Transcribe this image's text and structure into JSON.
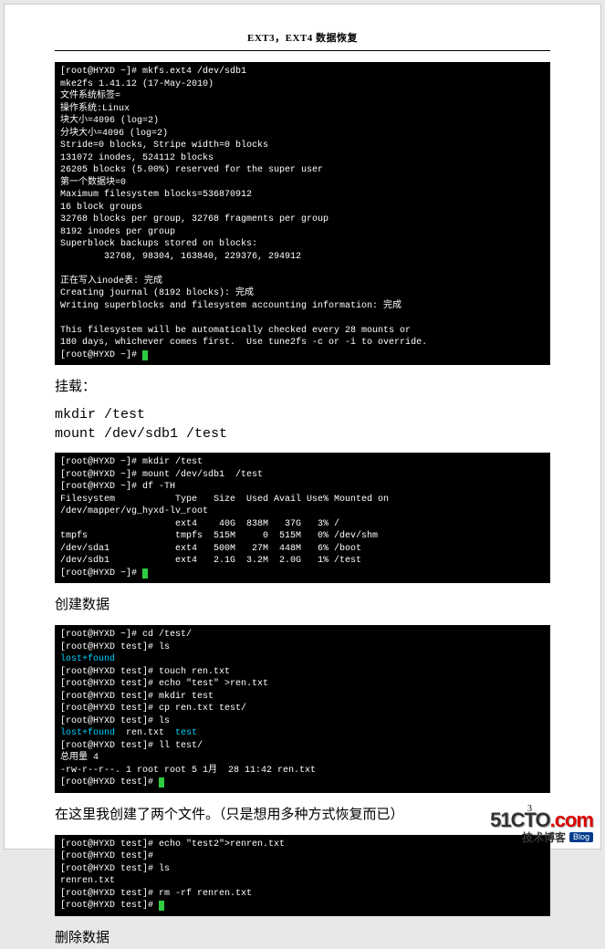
{
  "header": {
    "title": "EXT3，EXT4 数据恢复"
  },
  "terminal1": {
    "lines": [
      {
        "t": "[root@HYXD ~]# mkfs.ext4 /dev/sdb1"
      },
      {
        "t": "mke2fs 1.41.12 (17-May-2010)"
      },
      {
        "t": "文件系统标签="
      },
      {
        "t": "操作系统:Linux"
      },
      {
        "t": "块大小=4096 (log=2)"
      },
      {
        "t": "分块大小=4096 (log=2)"
      },
      {
        "t": "Stride=0 blocks, Stripe width=0 blocks"
      },
      {
        "t": "131072 inodes, 524112 blocks"
      },
      {
        "t": "26205 blocks (5.00%) reserved for the super user"
      },
      {
        "t": "第一个数据块=0"
      },
      {
        "t": "Maximum filesystem blocks=536870912"
      },
      {
        "t": "16 block groups"
      },
      {
        "t": "32768 blocks per group, 32768 fragments per group"
      },
      {
        "t": "8192 inodes per group"
      },
      {
        "t": "Superblock backups stored on blocks:"
      },
      {
        "t": "        32768, 98304, 163840, 229376, 294912"
      },
      {
        "t": ""
      },
      {
        "t": "正在写入inode表: 完成"
      },
      {
        "t": "Creating journal (8192 blocks): 完成"
      },
      {
        "t": "Writing superblocks and filesystem accounting information: 完成"
      },
      {
        "t": ""
      },
      {
        "t": "This filesystem will be automatically checked every 28 mounts or"
      },
      {
        "t": "180 days, whichever comes first.  Use tune2fs -c or -i to override."
      },
      {
        "t": "[root@HYXD ~]# ",
        "cursor": true
      }
    ]
  },
  "section1": {
    "title": "挂载：",
    "cmd1": "mkdir /test",
    "cmd2": "mount /dev/sdb1  /test"
  },
  "terminal2": {
    "lines": [
      {
        "t": "[root@HYXD ~]# mkdir /test"
      },
      {
        "t": "[root@HYXD ~]# mount /dev/sdb1  /test"
      },
      {
        "t": "[root@HYXD ~]# df -TH"
      },
      {
        "t": "Filesystem           Type   Size  Used Avail Use% Mounted on"
      },
      {
        "t": "/dev/mapper/vg_hyxd-lv_root"
      },
      {
        "t": "                     ext4    40G  838M   37G   3% /"
      },
      {
        "t": "tmpfs                tmpfs  515M     0  515M   0% /dev/shm"
      },
      {
        "t": "/dev/sda1            ext4   500M   27M  448M   6% /boot"
      },
      {
        "t": "/dev/sdb1            ext4   2.1G  3.2M  2.0G   1% /test"
      },
      {
        "t": "[root@HYXD ~]# ",
        "cursor": true
      }
    ]
  },
  "section2": {
    "title": "创建数据"
  },
  "terminal3": {
    "lines": [
      {
        "t": "[root@HYXD ~]# cd /test/"
      },
      {
        "t": "[root@HYXD test]# ls"
      },
      {
        "t": "lost+found",
        "cls": "cyan"
      },
      {
        "t": "[root@HYXD test]# touch ren.txt"
      },
      {
        "t": "[root@HYXD test]# echo \"test\" >ren.txt"
      },
      {
        "t": "[root@HYXD test]# mkdir test"
      },
      {
        "t": "[root@HYXD test]# cp ren.txt test/"
      },
      {
        "t": "[root@HYXD test]# ls"
      },
      {
        "parts": [
          {
            "t": "lost+found",
            "cls": "cyan"
          },
          {
            "t": "  ren.txt  "
          },
          {
            "t": "test",
            "cls": "cyan"
          }
        ]
      },
      {
        "t": "[root@HYXD test]# ll test/"
      },
      {
        "t": "总用量 4"
      },
      {
        "t": "-rw-r--r--. 1 root root 5 1月  28 11:42 ren.txt"
      },
      {
        "t": "[root@HYXD test]# ",
        "cursor": true
      }
    ]
  },
  "section3": {
    "text": "在这里我创建了两个文件。（只是想用多种方式恢复而已）"
  },
  "terminal4": {
    "lines": [
      {
        "t": "[root@HYXD test]# echo \"test2\">renren.txt"
      },
      {
        "t": "[root@HYXD test]# "
      },
      {
        "t": "[root@HYXD test]# ls"
      },
      {
        "t": "renren.txt"
      },
      {
        "t": "[root@HYXD test]# rm -rf renren.txt"
      },
      {
        "t": "[root@HYXD test]# ",
        "cursor": true
      }
    ]
  },
  "section4": {
    "title": "删除数据"
  },
  "pagenum": "3",
  "watermark": {
    "logo_a": "51CTO",
    "logo_b": ".com",
    "sub": "技术博客",
    "tag": "Blog"
  }
}
